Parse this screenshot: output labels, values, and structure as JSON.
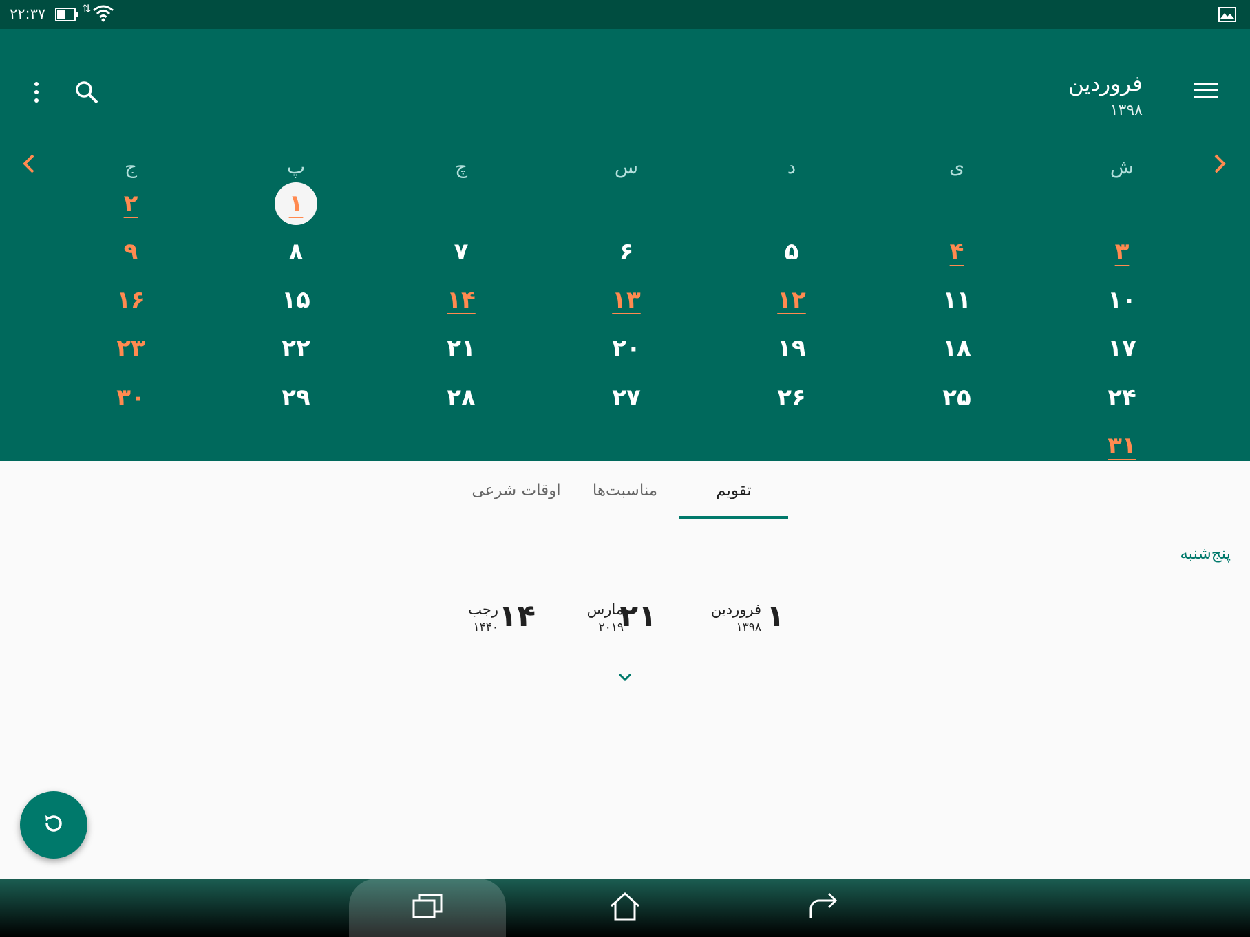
{
  "status_bar": {
    "time": "۲۲:۳۷",
    "data_arrows": "⇅"
  },
  "header": {
    "month": "فروردین",
    "year": "۱۳۹۸"
  },
  "weekdays": [
    "ش",
    "ی",
    "د",
    "س",
    "چ",
    "پ",
    "ج"
  ],
  "calendar": {
    "days": [
      {
        "label": "۱",
        "holiday": true,
        "event": true,
        "today": true
      },
      {
        "label": "۲",
        "holiday": true,
        "event": true
      },
      {
        "label": "۳",
        "holiday": true,
        "event": true
      },
      {
        "label": "۴",
        "holiday": true,
        "event": true
      },
      {
        "label": "۵"
      },
      {
        "label": "۶"
      },
      {
        "label": "۷"
      },
      {
        "label": "۸"
      },
      {
        "label": "۹",
        "holiday": true
      },
      {
        "label": "۱۰"
      },
      {
        "label": "۱۱"
      },
      {
        "label": "۱۲",
        "holiday": true,
        "event": true
      },
      {
        "label": "۱۳",
        "holiday": true,
        "event": true
      },
      {
        "label": "۱۴",
        "holiday": true,
        "event": true
      },
      {
        "label": "۱۵"
      },
      {
        "label": "۱۶",
        "holiday": true
      },
      {
        "label": "۱۷"
      },
      {
        "label": "۱۸"
      },
      {
        "label": "۱۹"
      },
      {
        "label": "۲۰"
      },
      {
        "label": "۲۱"
      },
      {
        "label": "۲۲"
      },
      {
        "label": "۲۳",
        "holiday": true
      },
      {
        "label": "۲۴"
      },
      {
        "label": "۲۵"
      },
      {
        "label": "۲۶"
      },
      {
        "label": "۲۷"
      },
      {
        "label": "۲۸"
      },
      {
        "label": "۲۹"
      },
      {
        "label": "۳۰",
        "holiday": true
      },
      {
        "label": "۳۱",
        "holiday": true,
        "event": true
      }
    ],
    "first_day_column": 5,
    "holiday_color": "#ff8a50",
    "header_color": "#00695c"
  },
  "tabs": [
    {
      "label": "تقویم",
      "active": true
    },
    {
      "label": "مناسبت‌ها"
    },
    {
      "label": "اوقات شرعی"
    }
  ],
  "selected_day": {
    "weekday": "پنج‌شنبه",
    "persian": {
      "day": "۱",
      "month": "فروردین",
      "year": "۱۳۹۸"
    },
    "gregorian": {
      "day": "۲۱",
      "month": "مارس",
      "year": "۲۰۱۹"
    },
    "islamic": {
      "day": "۱۴",
      "month": "رجب",
      "year": "۱۴۴۰"
    }
  },
  "icons": {
    "menu": "menu-icon",
    "more": "more-vert-icon",
    "search": "search-icon",
    "prev": "chevron-left-icon",
    "next": "chevron-right-icon",
    "expand": "chevron-down-icon",
    "fab": "refresh-icon",
    "recents": "recents-icon",
    "home": "home-icon",
    "back": "back-icon"
  },
  "accent_color": "#00796b"
}
